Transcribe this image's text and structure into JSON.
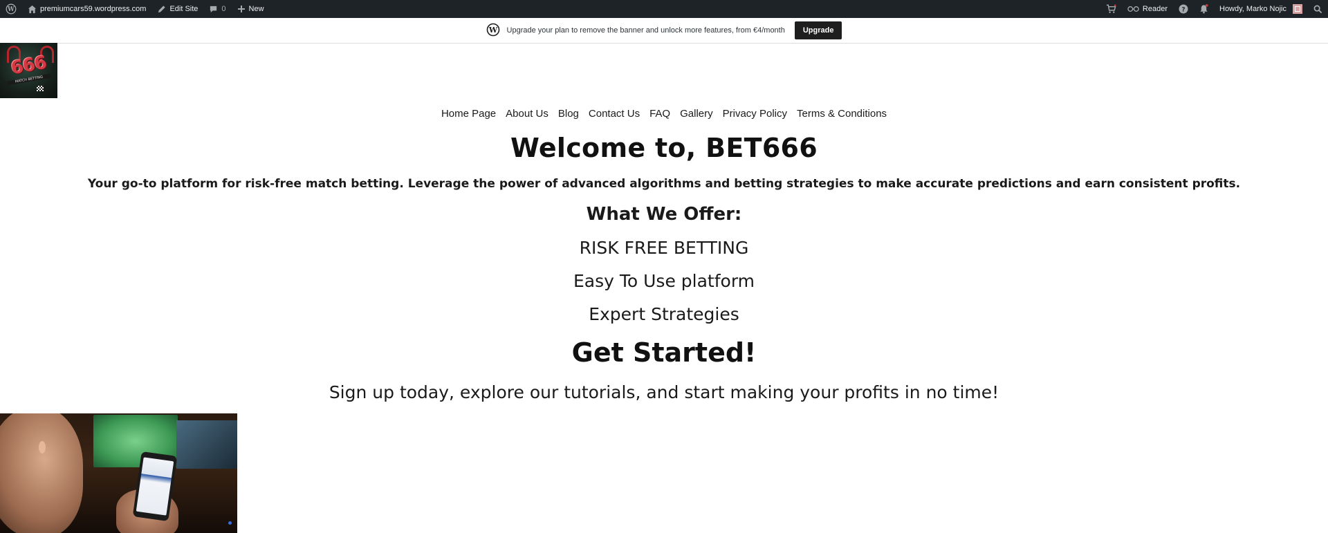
{
  "admin_bar": {
    "site_name": "premiumcars59.wordpress.com",
    "edit_site_label": "Edit Site",
    "comments_count": "0",
    "new_label": "New",
    "reader_label": "Reader",
    "greeting": "Howdy, Marko Nojic"
  },
  "banner": {
    "message": "Upgrade your plan to remove the banner and unlock more features, from €4/month",
    "button_label": "Upgrade"
  },
  "logo": {
    "text": "666",
    "subtext": "MATCH BETTING"
  },
  "nav": {
    "items": [
      "Home Page",
      "About Us",
      "Blog",
      "Contact Us",
      "FAQ",
      "Gallery",
      "Privacy Policy",
      "Terms & Conditions"
    ]
  },
  "hero": {
    "title": "Welcome to, BET666",
    "lead": "Your go-to platform for risk-free match betting. Leverage the power of advanced algorithms and betting strategies to make accurate predictions and earn consistent profits.",
    "offer_heading": "What We Offer:",
    "features": [
      "RISK FREE BETTING",
      "Easy To Use platform",
      "Expert Strategies"
    ],
    "cta": "Get Started!",
    "signup": "Sign up today, explore our tutorials, and start making your profits in no time!"
  },
  "icons": [
    "wordpress-icon",
    "home-icon",
    "pencil-icon",
    "comment-icon",
    "plus-icon",
    "cart-icon",
    "glasses-icon",
    "help-icon",
    "bell-icon",
    "search-icon"
  ]
}
